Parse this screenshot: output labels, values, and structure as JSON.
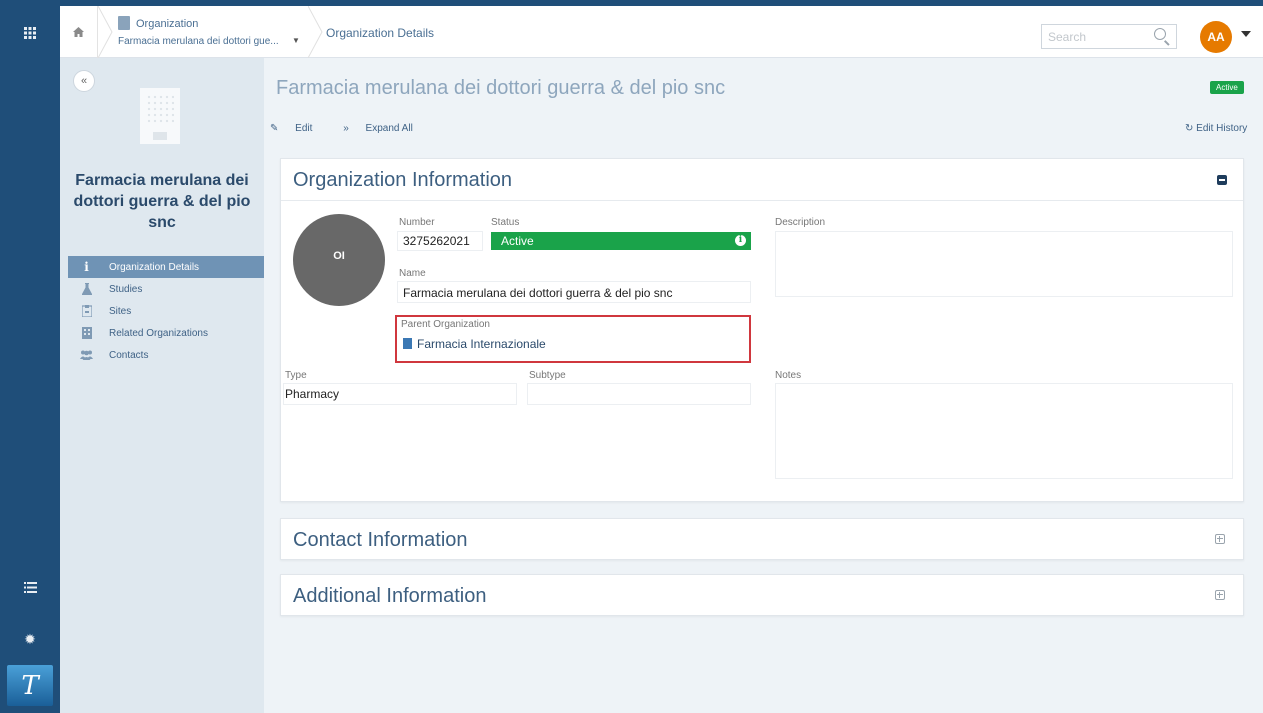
{
  "topbar": {
    "breadcrumb_org_label": "Organization",
    "breadcrumb_org_value": "Farmacia merulana dei dottori gue...",
    "breadcrumb_current": "Organization Details",
    "search_placeholder": "Search",
    "avatar_initials": "AA"
  },
  "sidebar": {
    "collapse_label": "«",
    "org_name": "Farmacia merulana dei dottori guerra & del pio snc",
    "items": [
      {
        "label": "Organization Details",
        "icon": "info-icon",
        "active": true
      },
      {
        "label": "Studies",
        "icon": "flask-icon",
        "active": false
      },
      {
        "label": "Sites",
        "icon": "site-icon",
        "active": false
      },
      {
        "label": "Related Organizations",
        "icon": "building-icon",
        "active": false
      },
      {
        "label": "Contacts",
        "icon": "users-icon",
        "active": false
      }
    ]
  },
  "main": {
    "title": "Farmacia merulana dei dottori guerra & del pio snc",
    "status_badge": "Active",
    "edit_label": "Edit",
    "expand_all_label": "Expand All",
    "edit_history_label": "Edit History"
  },
  "org_info": {
    "title": "Organization Information",
    "avatar_initials": "OI",
    "number_label": "Number",
    "number_value": "3275262021",
    "status_label": "Status",
    "status_value": "Active",
    "name_label": "Name",
    "name_value": "Farmacia merulana dei dottori guerra & del pio snc",
    "parent_label": "Parent Organization",
    "parent_value": "Farmacia Internazionale",
    "description_label": "Description",
    "type_label": "Type",
    "type_value": "Pharmacy",
    "subtype_label": "Subtype",
    "notes_label": "Notes"
  },
  "contact_info": {
    "title": "Contact Information"
  },
  "additional_info": {
    "title": "Additional Information"
  },
  "colors": {
    "rail": "#1f4e79",
    "active_green": "#1aa34a",
    "avatar_orange": "#e67a00",
    "highlight_red": "#d0373e"
  }
}
